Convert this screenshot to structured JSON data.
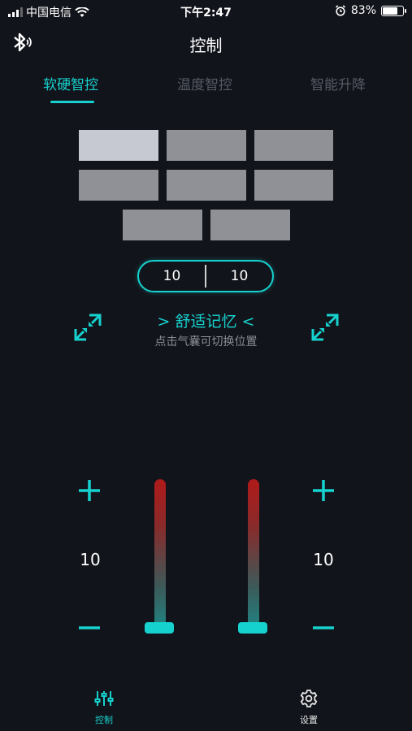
{
  "status_bar": {
    "carrier": "中国电信",
    "time": "下午2:47",
    "battery": "83%",
    "battery_level": 0.83
  },
  "header": {
    "title": "控制"
  },
  "tabs": [
    {
      "label": "软硬智控",
      "active": true
    },
    {
      "label": "温度智控",
      "active": false
    },
    {
      "label": "智能升降",
      "active": false
    }
  ],
  "airbags": {
    "selected_index": 0,
    "count": 8
  },
  "values": {
    "left": "10",
    "right": "10"
  },
  "memory": {
    "label": "> 舒适记忆 <",
    "hint": "点击气囊可切换位置"
  },
  "left_control": {
    "value": "10",
    "level": 0.0
  },
  "right_control": {
    "value": "10",
    "level": 0.0
  },
  "bottom_nav": [
    {
      "label": "控制",
      "icon": "sliders-icon",
      "active": true
    },
    {
      "label": "设置",
      "icon": "gear-icon",
      "active": false
    }
  ],
  "colors": {
    "accent": "#16d2cf",
    "background": "#12141b",
    "slider_top": "#b01a1a"
  }
}
